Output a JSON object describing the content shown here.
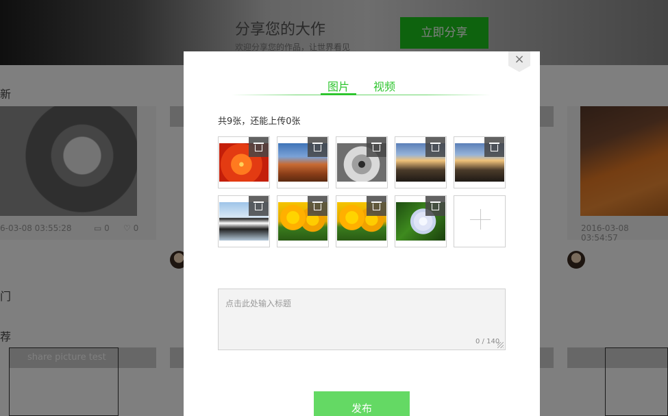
{
  "background": {
    "banner_title": "分享您的大作",
    "banner_subtitle": "欢迎分享您的作品，让世界看见",
    "banner_button": "立即分享",
    "section_newest": "新",
    "section_hot": "门",
    "section_recommend": "荐",
    "card_left": {
      "date": "6-03-08 03:55:28",
      "comments": "0",
      "likes": "0"
    },
    "card_right": {
      "date": "2016-03-08 03:54:57"
    },
    "bottom_card_title": "share picture test"
  },
  "modal": {
    "close_label": "×",
    "tabs": [
      {
        "label": "图片",
        "active": true
      },
      {
        "label": "视频",
        "active": false
      }
    ],
    "count_text": "共9张，还能上传0张",
    "images": [
      {
        "name": "flower",
        "icon": "trash-icon"
      },
      {
        "name": "desert",
        "icon": "trash-icon"
      },
      {
        "name": "koala",
        "icon": "trash-icon"
      },
      {
        "name": "lighthouse",
        "icon": "trash-icon"
      },
      {
        "name": "lighthouse",
        "icon": "trash-icon"
      },
      {
        "name": "penguins",
        "icon": "trash-icon"
      },
      {
        "name": "tulips",
        "icon": "trash-icon"
      },
      {
        "name": "tulips",
        "icon": "trash-icon"
      },
      {
        "name": "hydrangea",
        "icon": "trash-icon"
      }
    ],
    "add_icon": "plus-icon",
    "title_placeholder": "点击此处输入标题",
    "char_count": "0 / 140",
    "publish_label": "发布"
  },
  "colors": {
    "accent": "#2ec52e",
    "publish_button": "#64d964",
    "banner_button": "#1cc71c",
    "overlay": "rgba(0,0,0,0.5)"
  }
}
